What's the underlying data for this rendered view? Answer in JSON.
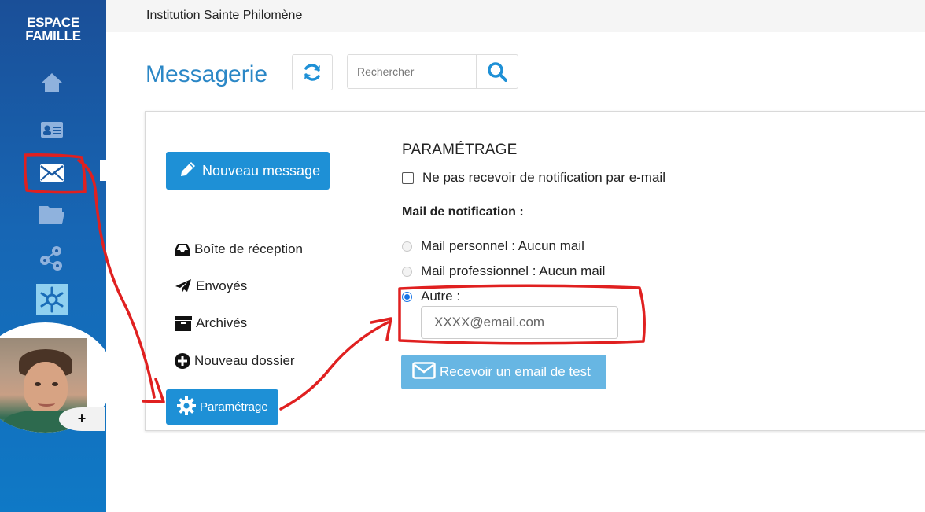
{
  "sidebar": {
    "brand_line1": "ESPACE",
    "brand_line2": "FAMILLE",
    "items": [
      {
        "name": "home",
        "icon": "home-icon"
      },
      {
        "name": "id-card",
        "icon": "id-card-icon"
      },
      {
        "name": "messagerie",
        "icon": "envelope-icon",
        "active": true
      },
      {
        "name": "documents",
        "icon": "folder-icon"
      },
      {
        "name": "network",
        "icon": "network-icon"
      },
      {
        "name": "snowflake",
        "icon": "snowflake-icon"
      }
    ],
    "profile_badge": "+"
  },
  "header": {
    "institution": "Institution Sainte Philomène"
  },
  "page": {
    "title": "Messagerie",
    "search_placeholder": "Rechercher"
  },
  "mail_nav": {
    "new_message": "Nouveau message",
    "items": [
      {
        "label": "Boîte de réception",
        "icon": "inbox-icon"
      },
      {
        "label": "Envoyés",
        "icon": "paper-plane-icon"
      },
      {
        "label": "Archivés",
        "icon": "archive-icon"
      },
      {
        "label": "Nouveau dossier",
        "icon": "plus-circle-icon"
      }
    ],
    "settings": "Paramétrage"
  },
  "settings": {
    "title": "PARAMÉTRAGE",
    "no_notification_label": "Ne pas recevoir de notification par e-mail",
    "no_notification_checked": false,
    "notification_heading": "Mail de notification :",
    "options": [
      {
        "label": "Mail personnel : Aucun mail",
        "selected": false
      },
      {
        "label": "Mail professionnel : Aucun mail",
        "selected": false
      },
      {
        "label": "Autre :",
        "selected": true
      }
    ],
    "other_email_placeholder": "XXXX@email.com",
    "test_button": "Recevoir un email de test"
  },
  "colors": {
    "primary": "#1e90d6",
    "title": "#2b87c6",
    "test_button": "#67b6e3",
    "annotation": "#e02020"
  }
}
